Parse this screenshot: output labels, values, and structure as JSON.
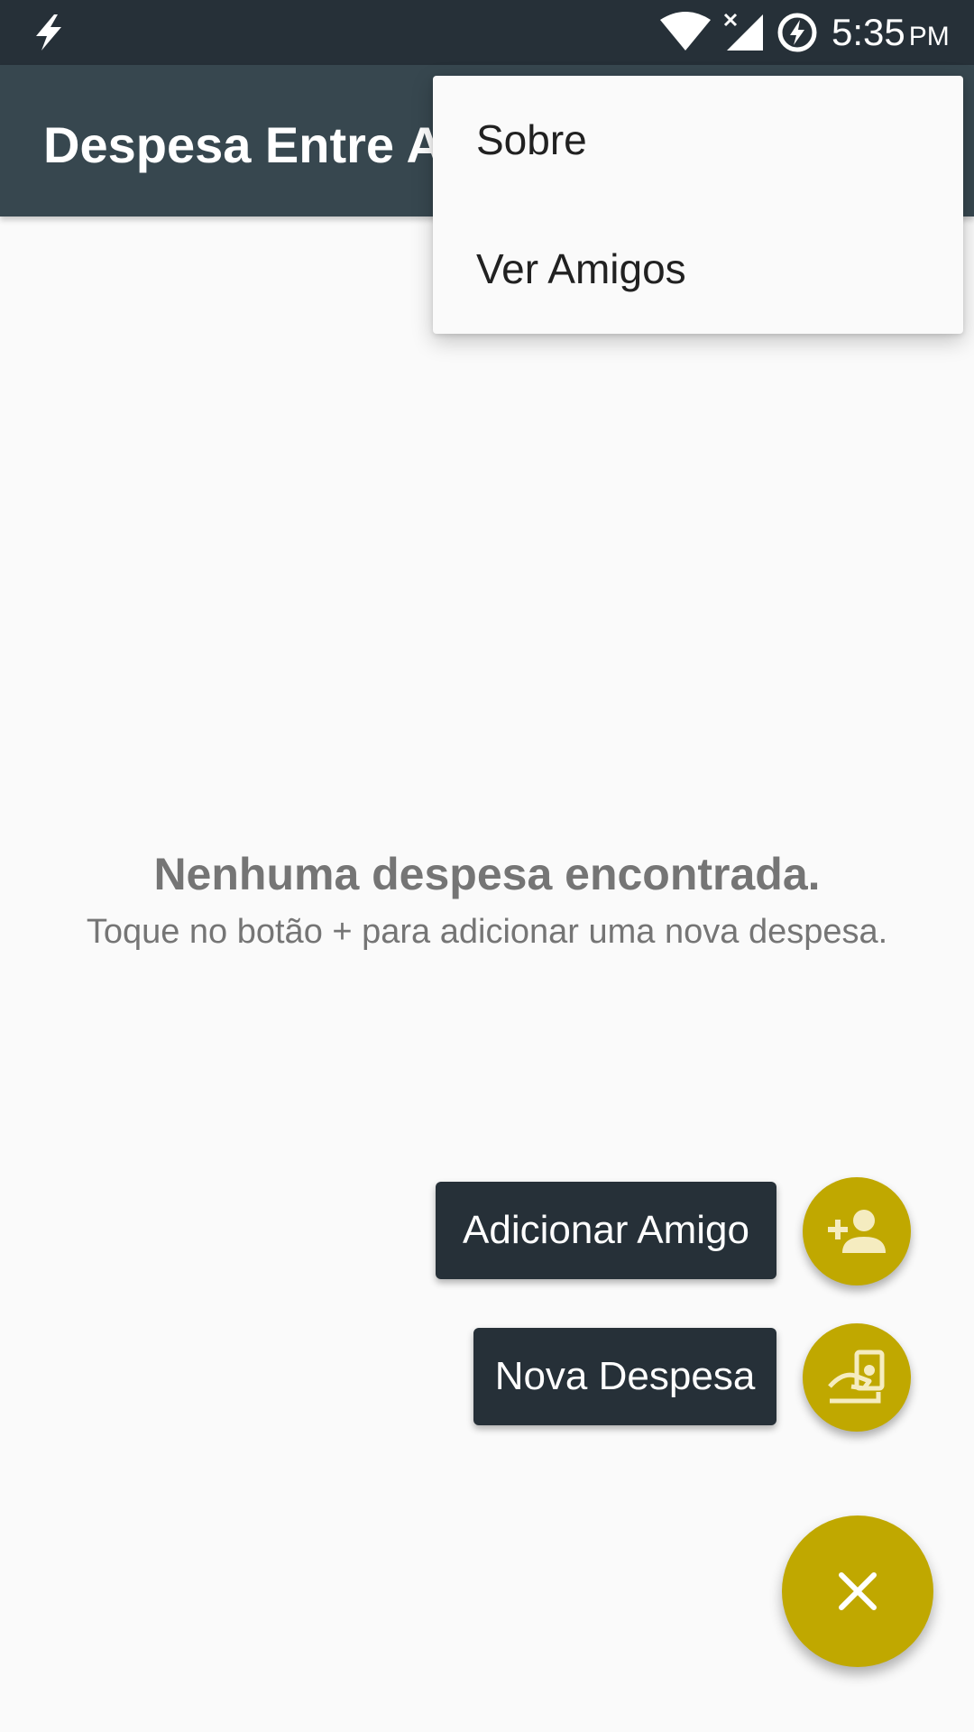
{
  "status_bar": {
    "time": "5:35",
    "ampm": "PM",
    "left_icon": "flash-icon",
    "wifi_icon": "wifi-icon",
    "signal_icon": "signal-no-data-icon",
    "battery_icon": "battery-charging-icon"
  },
  "app_bar": {
    "title": "Despesa Entre Amigos"
  },
  "overflow_menu": {
    "items": [
      {
        "label": "Sobre"
      },
      {
        "label": "Ver Amigos"
      }
    ]
  },
  "empty_state": {
    "title": "Nenhuma despesa encontrada.",
    "subtitle": "Toque no botão + para adicionar uma nova despesa."
  },
  "fab_menu": {
    "add_friend": {
      "label": "Adicionar Amigo",
      "icon": "person-add-icon"
    },
    "new_expense": {
      "label": "Nova Despesa",
      "icon": "pay-money-icon"
    },
    "main": {
      "icon": "close-icon"
    }
  },
  "colors": {
    "status_bar": "#263038",
    "app_bar": "#37474f",
    "accent": "#c0a800",
    "label_bg": "#263038",
    "background": "#fafafa",
    "empty_text": "#757575"
  }
}
